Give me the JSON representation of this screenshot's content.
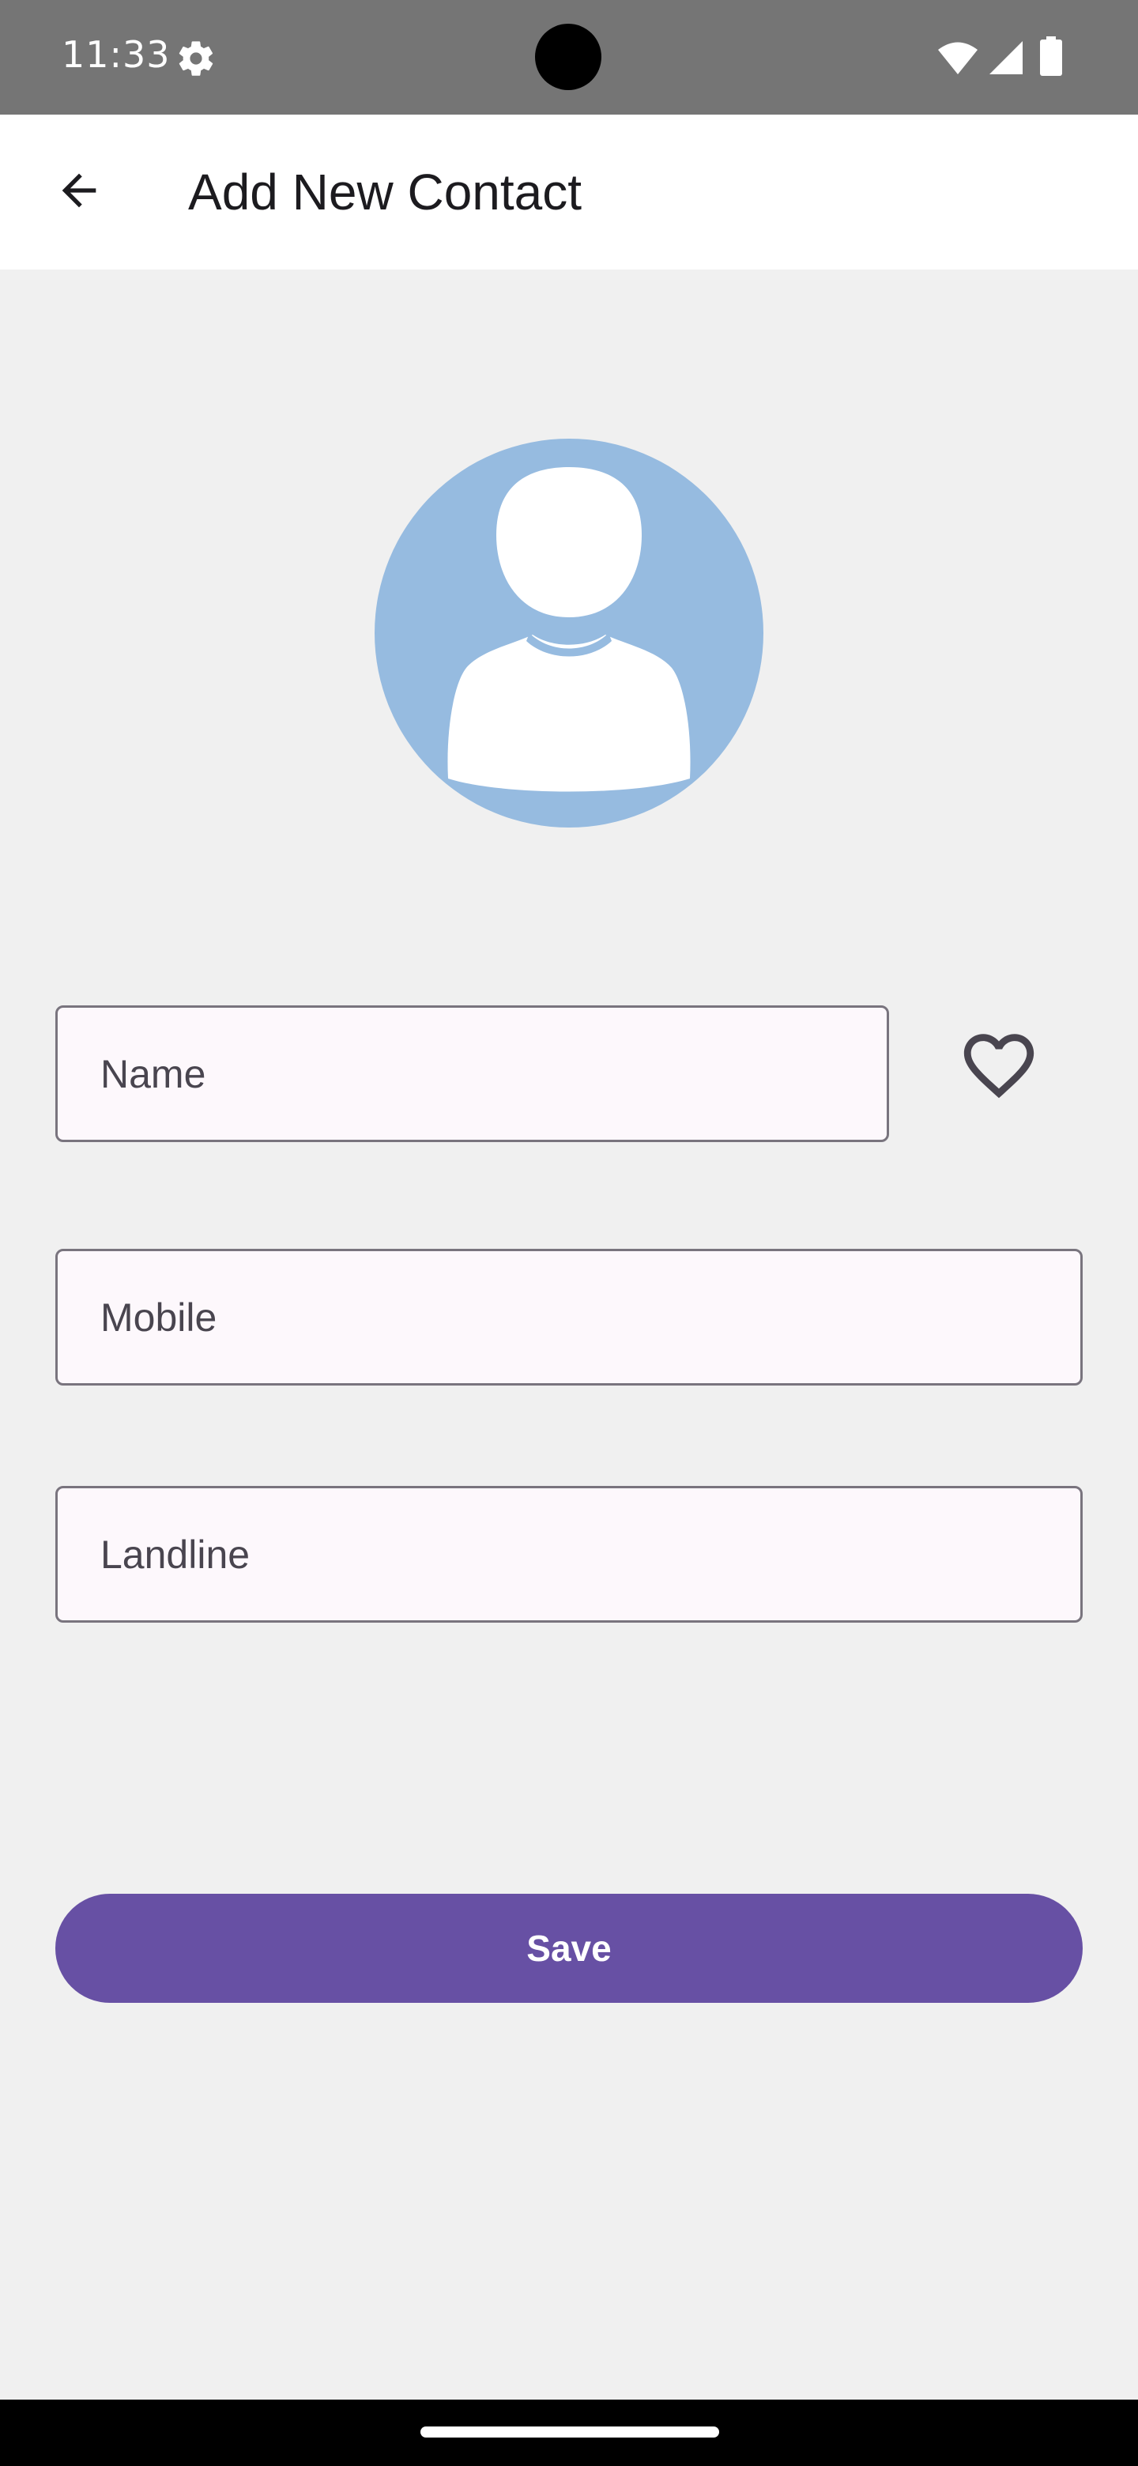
{
  "status_bar": {
    "time": "11:33",
    "icons": [
      "settings-gear-icon",
      "wifi-icon",
      "cell-signal-icon",
      "battery-icon"
    ]
  },
  "app_bar": {
    "back_icon": "arrow-back-icon",
    "title": "Add New Contact"
  },
  "avatar": {
    "icon": "person-avatar-icon",
    "background_color": "#96bbe0"
  },
  "form": {
    "name": {
      "value": "",
      "placeholder": "Name"
    },
    "favorite_icon": "heart-outline-icon",
    "mobile": {
      "value": "",
      "placeholder": "Mobile"
    },
    "landline": {
      "value": "",
      "placeholder": "Landline"
    },
    "save_label": "Save"
  },
  "colors": {
    "accent": "#6750a4",
    "status_bar": "#757575",
    "background": "#f0f0f0"
  }
}
